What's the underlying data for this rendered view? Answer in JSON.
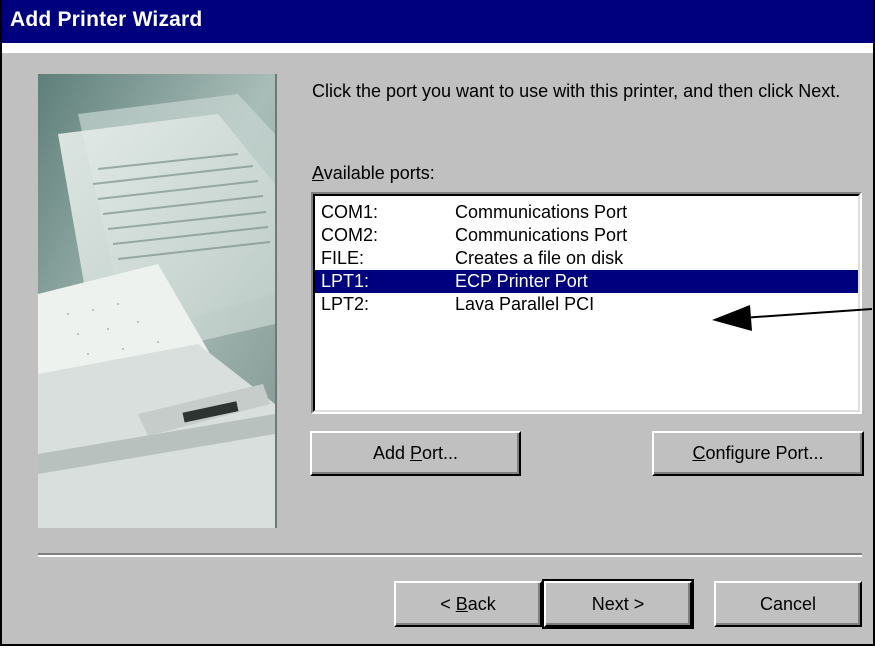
{
  "window": {
    "title": "Add Printer Wizard"
  },
  "instruction": "Click the port you want to use with this printer, and then click Next.",
  "ports_label": {
    "access_key": "A",
    "rest": "vailable ports:"
  },
  "ports": [
    {
      "port": "COM1:",
      "description": "Communications Port",
      "selected": false
    },
    {
      "port": "COM2:",
      "description": "Communications Port",
      "selected": false
    },
    {
      "port": "FILE:",
      "description": "Creates a file on disk",
      "selected": false
    },
    {
      "port": "LPT1:",
      "description": "ECP Printer Port",
      "selected": true
    },
    {
      "port": "LPT2:",
      "description": "Lava Parallel PCI",
      "selected": false
    }
  ],
  "buttons": {
    "add_port": {
      "pre": "Add ",
      "key": "P",
      "post": "ort..."
    },
    "configure_port": {
      "pre": "",
      "key": "C",
      "post": "onfigure Port..."
    },
    "back": {
      "pre": "< ",
      "key": "B",
      "post": "ack"
    },
    "next": {
      "label": "Next >"
    },
    "cancel": {
      "label": "Cancel"
    }
  },
  "colors": {
    "titlebar": "#00007f",
    "face": "#c0c0c0",
    "selection": "#00007f"
  },
  "icons": {
    "wizard_graphic": "printer-with-paper-illustration",
    "annotation": "arrow-icon"
  }
}
